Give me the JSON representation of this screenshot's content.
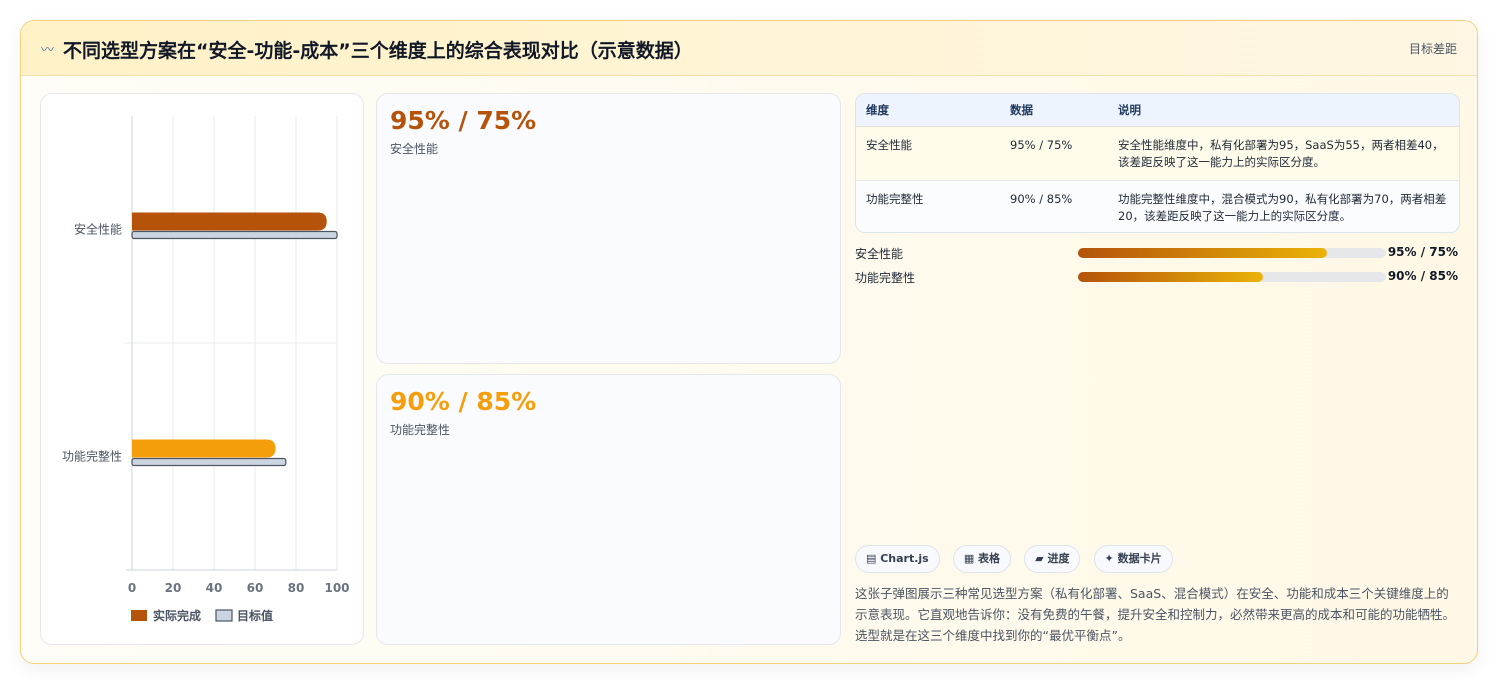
{
  "header": {
    "icon": "〰",
    "title": "不同选型方案在“安全-功能-成本”三个维度上的综合表现对比（示意数据）",
    "right_label": "目标差距"
  },
  "kpis": [
    {
      "value": "95% / 75%",
      "label": "安全性能",
      "color": "#b45309"
    },
    {
      "value": "90% / 85%",
      "label": "功能完整性",
      "color": "#f59e0b"
    }
  ],
  "table": {
    "headers": [
      "维度",
      "数据",
      "说明"
    ],
    "rows": [
      [
        "安全性能",
        "95% / 75%",
        "安全性能维度中，私有化部署为95，SaaS为55，两者相差40，该差距反映了这一能力上的实际区分度。"
      ],
      [
        "功能完整性",
        "90% / 85%",
        "功能完整性维度中，混合模式为90，私有化部署为70，两者相差20，该差距反映了这一能力上的实际区分度。"
      ]
    ]
  },
  "progress": [
    {
      "label": "安全性能",
      "value_text": "95% / 75%",
      "fraction": 0.81
    },
    {
      "label": "功能完整性",
      "value_text": "90% / 85%",
      "fraction": 0.6
    }
  ],
  "tags": [
    "▤ Chart.js",
    "▦ 表格",
    "▰ 进度",
    "✦ 数据卡片"
  ],
  "description": "这张子弹图展示三种常见选型方案（私有化部署、SaaS、混合模式）在安全、功能和成本三个关键维度上的示意表现。它直观地告诉你：没有免费的午餐，提升安全和控制力，必然带来更高的成本和可能的功能牺牲。选型就是在这三个维度中找到你的“最优平衡点”。",
  "chart_data": {
    "type": "bar",
    "orientation": "horizontal",
    "categories": [
      "安全性能",
      "功能完整性"
    ],
    "series": [
      {
        "name": "实际完成",
        "values": [
          95,
          70
        ],
        "color": "#b45309",
        "alt_colors": [
          "#b45309",
          "#f59e0b"
        ]
      },
      {
        "name": "目标值",
        "values": [
          100,
          75
        ],
        "color": "#cbd5e1"
      }
    ],
    "xlim": [
      0,
      100
    ],
    "xticks": [
      0,
      20,
      40,
      60,
      80,
      100
    ],
    "grid": true,
    "legend": "bottom"
  }
}
